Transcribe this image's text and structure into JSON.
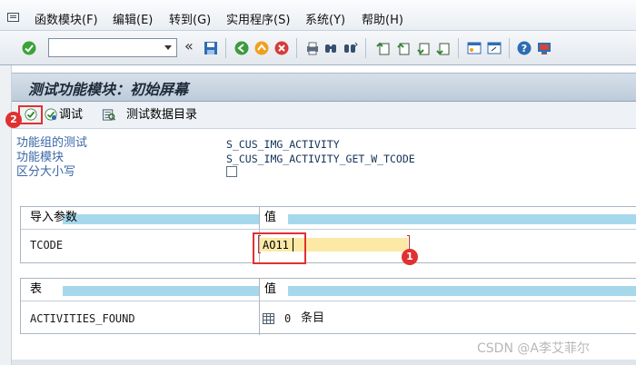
{
  "menu": {
    "items": [
      "函数模块(F)",
      "编辑(E)",
      "转到(G)",
      "实用程序(S)",
      "系统(Y)",
      "帮助(H)"
    ]
  },
  "toolbar": {
    "command_field_value": "",
    "icons": [
      "enter-icon",
      "dropdown-icon",
      "collapse-icon",
      "save-icon",
      "back-icon",
      "exit-icon",
      "cancel-icon",
      "print-icon",
      "find-icon",
      "find-next-icon",
      "first-page-icon",
      "previous-page-icon",
      "next-page-icon",
      "last-page-icon",
      "new-session-icon",
      "shortcut-icon",
      "help-icon",
      "customize-layout-icon"
    ],
    "collapse_glyph": "«"
  },
  "title": "测试功能模块：初始屏幕",
  "app_toolbar": {
    "debug_label": "调试",
    "test_data_label": "测试数据目录"
  },
  "markers": {
    "one": "1",
    "two": "2"
  },
  "header": {
    "function_group_label": "功能组的测试",
    "function_group_value": "S_CUS_IMG_ACTIVITY",
    "function_module_label": "功能模块",
    "function_module_value": "S_CUS_IMG_ACTIVITY_GET_W_TCODE",
    "case_sensitive_label": "区分大小写",
    "case_sensitive_checked": false
  },
  "import_table": {
    "col1": "导入参数",
    "col2": "值",
    "rows": [
      {
        "name": "TCODE",
        "value": "AO11"
      }
    ]
  },
  "tables_table": {
    "col1": "表",
    "col2": "值",
    "rows": [
      {
        "name": "ACTIVITIES_FOUND",
        "count": "0",
        "unit": "条目"
      }
    ]
  },
  "watermark": "CSDN @A李艾菲尔",
  "colors": {
    "highlight": "#e03131",
    "header_band": "#a6d8ec",
    "input_bg": "#fce9a6"
  }
}
